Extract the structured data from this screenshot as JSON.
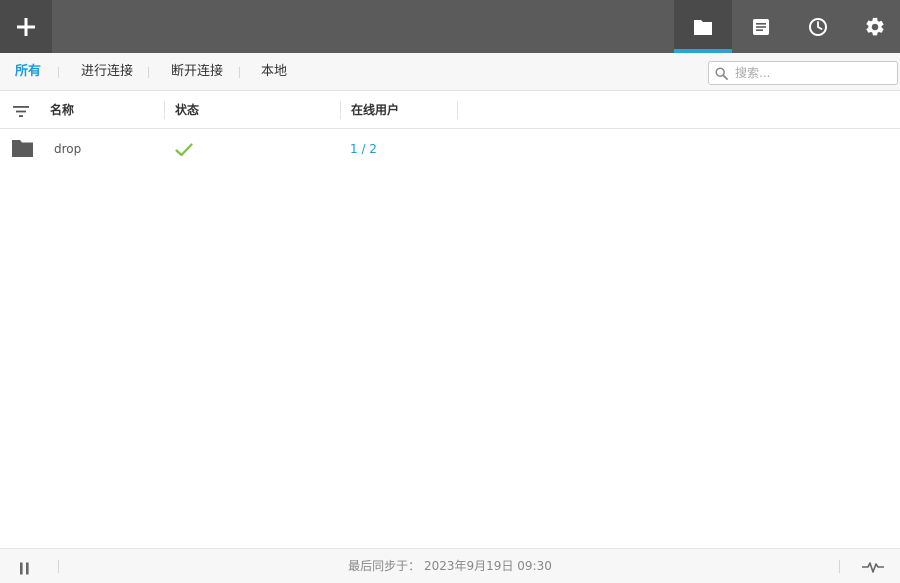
{
  "topbar": {
    "add_icon": "plus-icon",
    "nav": [
      {
        "icon": "folder-icon",
        "active": true
      },
      {
        "icon": "document-icon",
        "active": false
      },
      {
        "icon": "clock-icon",
        "active": false
      },
      {
        "icon": "gear-icon",
        "active": false
      }
    ],
    "accent_color": "#2aa3d9"
  },
  "filter": {
    "tabs": [
      {
        "label": "所有",
        "active": true
      },
      {
        "label": "进行连接",
        "active": false
      },
      {
        "label": "断开连接",
        "active": false
      },
      {
        "label": "本地",
        "active": false
      }
    ],
    "search_placeholder": "搜索..."
  },
  "table": {
    "columns": [
      "名称",
      "状态",
      "在线用户"
    ],
    "rows": [
      {
        "icon": "folder-icon",
        "name": "drop",
        "status_icon": "check-icon",
        "online": "1 / 2"
      }
    ],
    "status_ok_color": "#7cc242",
    "link_color": "#1f9bd1"
  },
  "footer": {
    "sync_label": "最后同步于：",
    "sync_time": "2023年9月19日 09:30"
  }
}
